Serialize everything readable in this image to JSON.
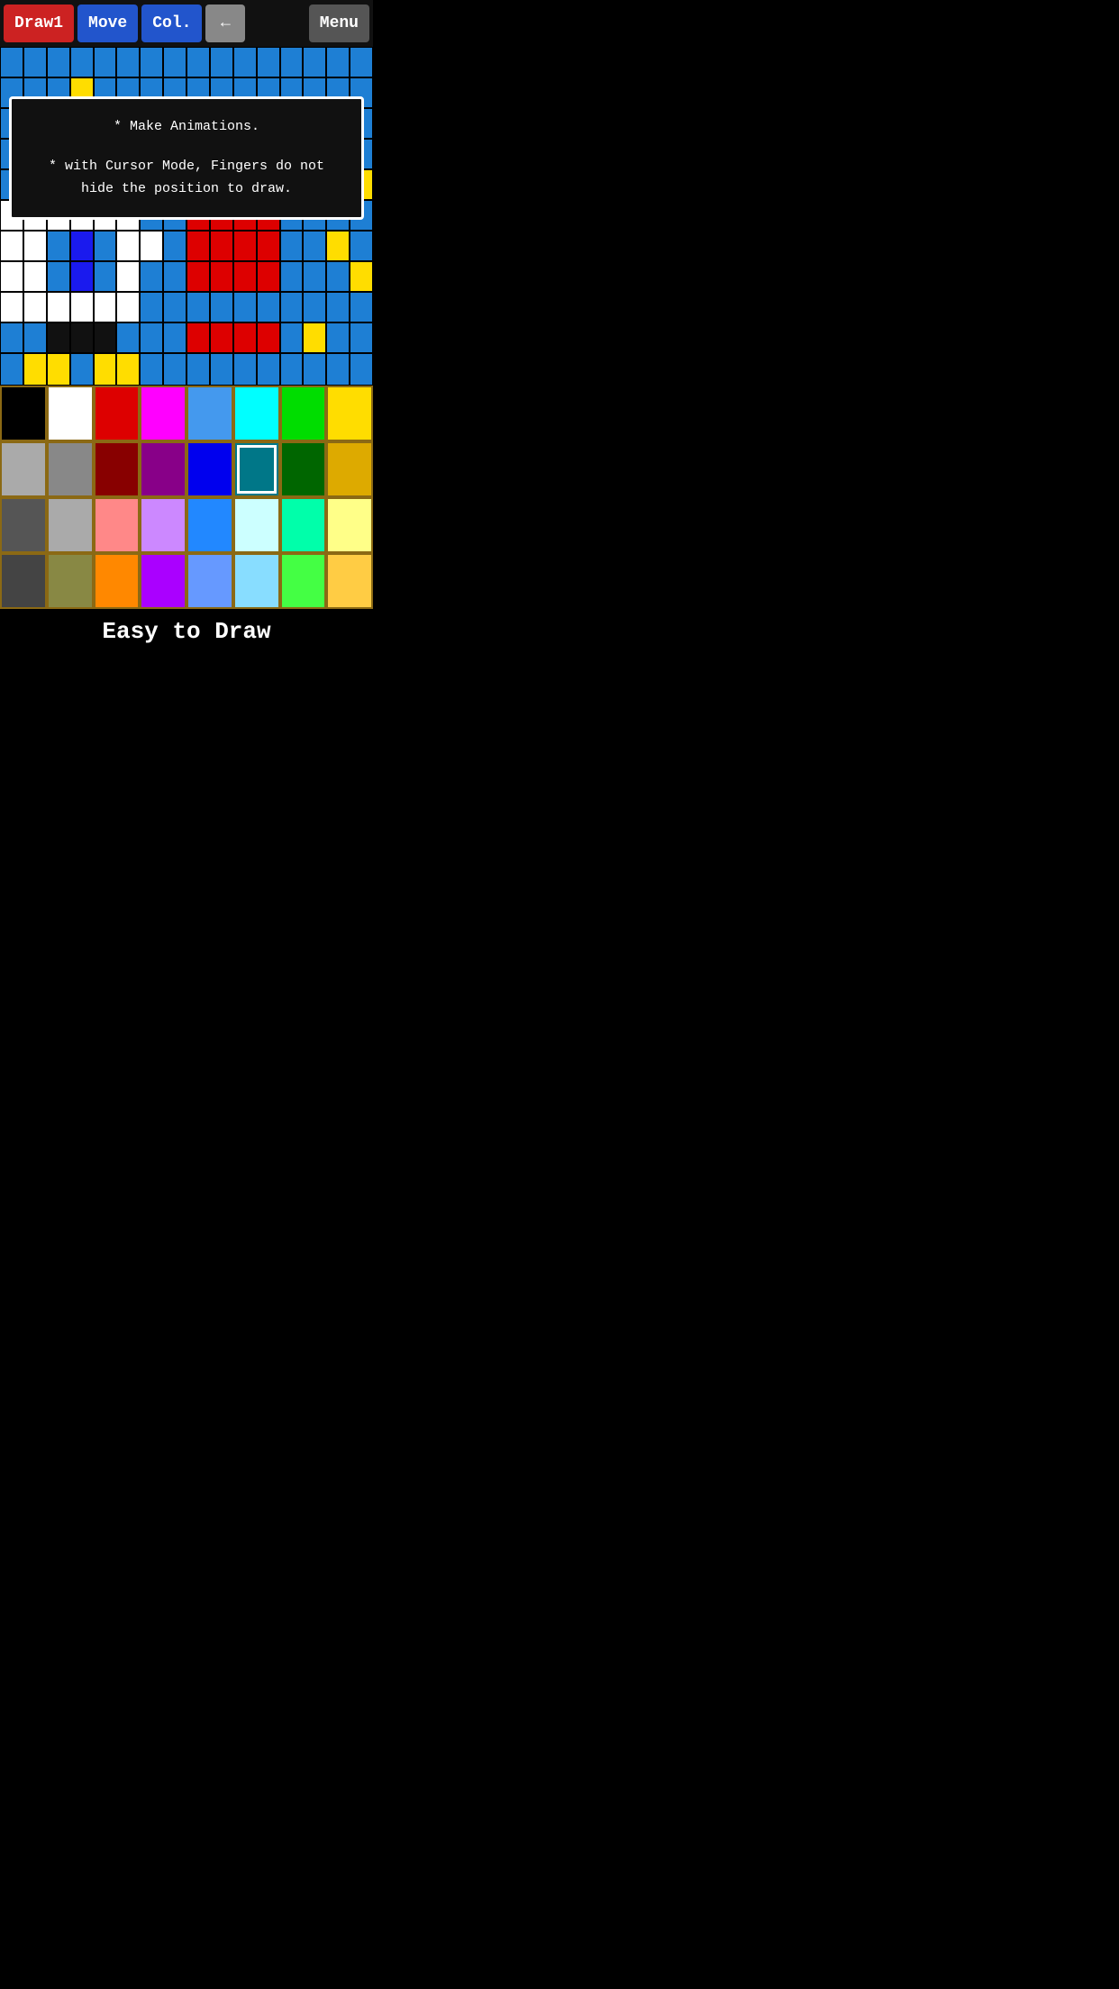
{
  "toolbar": {
    "draw_label": "Draw1",
    "move_label": "Move",
    "col_label": "Col.",
    "back_arrow": "←",
    "menu_label": "Menu"
  },
  "dialog": {
    "line1": "* Make Animations.",
    "line2": "* with Cursor Mode, Fingers do not",
    "line3": "hide the position to draw."
  },
  "bottom_label": "Easy to Draw",
  "palette": {
    "colors": [
      "#000000",
      "#ffffff",
      "#dd0000",
      "#ff00ff",
      "#4499ee",
      "#00ffff",
      "#00dd00",
      "#ffdd00",
      "#aaaaaa",
      "#888888",
      "#880000",
      "#880088",
      "#0000ee",
      "#007788",
      "#006600",
      "#ddaa00",
      "#555555",
      "#aaaaaa",
      "#ff8888",
      "#cc88ff",
      "#2288ff",
      "#ccffff",
      "#00ffaa",
      "#ffff88",
      "#444444",
      "#888844",
      "#ff8800",
      "#aa00ff",
      "#6699ff",
      "#88ddff",
      "#44ff44",
      "#ffcc44"
    ],
    "selected_index": 13
  },
  "pixel_canvas": {
    "rows": 9,
    "cols": 16,
    "grid": [
      [
        "b",
        "b",
        "b",
        "b",
        "b",
        "b",
        "b",
        "b",
        "b",
        "b",
        "b",
        "b",
        "b",
        "b",
        "b",
        "b"
      ],
      [
        "b",
        "b",
        "b",
        "y",
        "b",
        "b",
        "b",
        "b",
        "b",
        "b",
        "b",
        "b",
        "b",
        "b",
        "b",
        "b"
      ],
      [
        "b",
        "r",
        "r",
        "r",
        "r",
        "b",
        "b",
        "b",
        "b",
        "b",
        "b",
        "b",
        "b",
        "b",
        "b",
        "b"
      ],
      [
        "b",
        "r",
        "r",
        "r",
        "r",
        "b",
        "b",
        "b",
        "b",
        "k",
        "b",
        "b",
        "b",
        "b",
        "b",
        "b"
      ],
      [
        "b",
        "r",
        "r",
        "r",
        "r",
        "b",
        "b",
        "b",
        "w",
        "w",
        "w",
        "b",
        "b",
        "y",
        "b",
        "y"
      ],
      [
        "w",
        "w",
        "w",
        "w",
        "w",
        "w",
        "b",
        "b",
        "r",
        "r",
        "r",
        "r",
        "b",
        "b",
        "b",
        "b"
      ],
      [
        "w",
        "w",
        "b",
        "n",
        "b",
        "w",
        "w",
        "b",
        "r",
        "r",
        "r",
        "r",
        "b",
        "b",
        "y",
        "b"
      ],
      [
        "w",
        "w",
        "b",
        "n",
        "b",
        "w",
        "b",
        "b",
        "r",
        "r",
        "r",
        "r",
        "b",
        "b",
        "b",
        "y"
      ],
      [
        "w",
        "w",
        "w",
        "w",
        "w",
        "w",
        "b",
        "b",
        "b",
        "b",
        "b",
        "b",
        "b",
        "b",
        "b",
        "b"
      ],
      [
        "b",
        "b",
        "k",
        "k",
        "k",
        "b",
        "b",
        "b",
        "r",
        "r",
        "r",
        "r",
        "b",
        "y",
        "b",
        "b"
      ]
    ]
  },
  "bottom_strip": {
    "colors": [
      "b",
      "y",
      "y",
      "b",
      "y",
      "y",
      "b",
      "b",
      "b",
      "b",
      "b",
      "b",
      "b",
      "b",
      "b",
      "b"
    ]
  }
}
